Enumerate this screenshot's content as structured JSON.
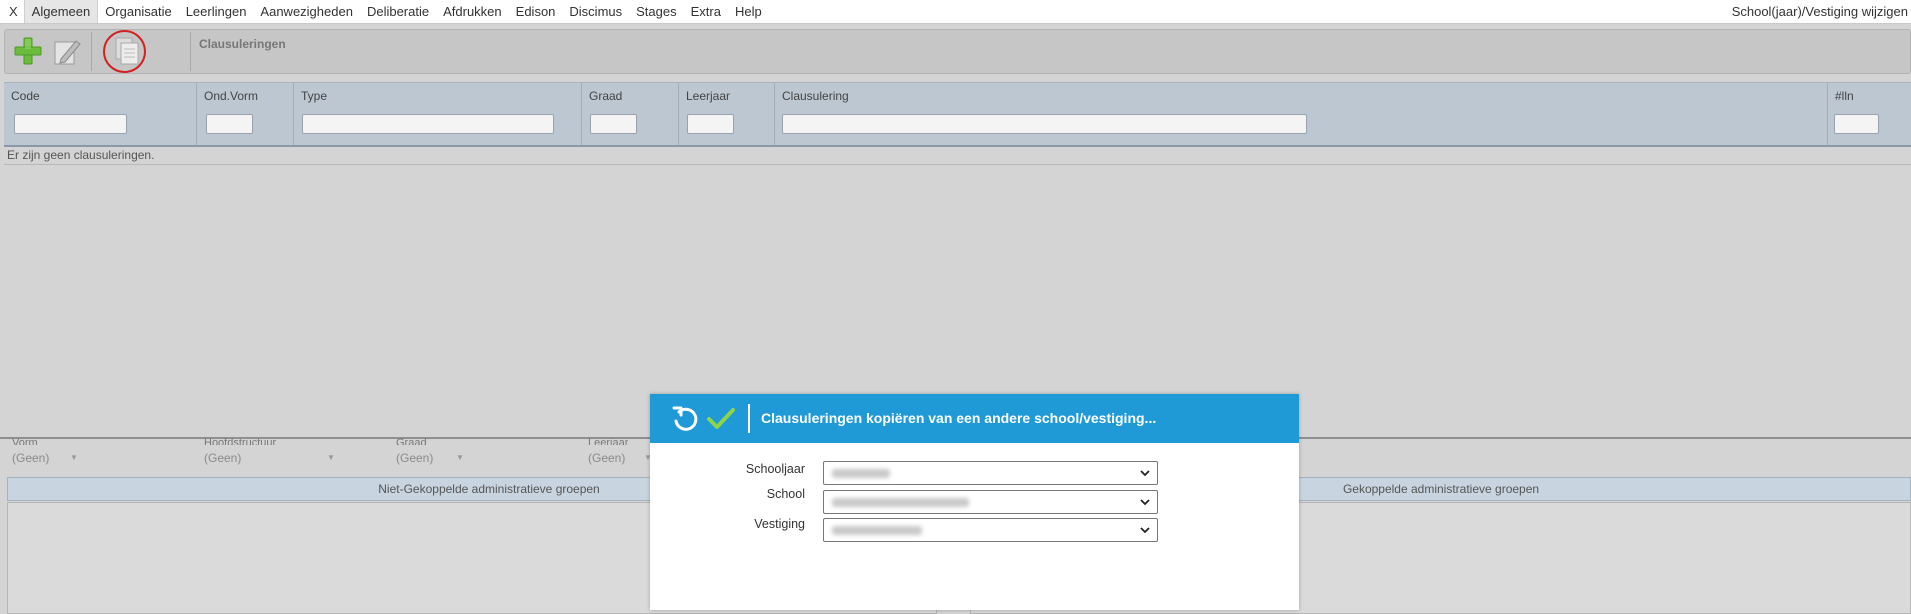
{
  "menu": {
    "close_label": "X",
    "items": [
      "Algemeen",
      "Organisatie",
      "Leerlingen",
      "Aanwezigheden",
      "Deliberatie",
      "Afdrukken",
      "Edison",
      "Discimus",
      "Stages",
      "Extra",
      "Help"
    ],
    "right_label": "School(jaar)/Vestiging wijzigen"
  },
  "toolbar": {
    "title": "Clausuleringen",
    "add_icon": "plus-icon",
    "edit_icon": "pencil-icon",
    "copy_icon": "copy-document-icon"
  },
  "grid": {
    "columns": [
      "Code",
      "Ond.Vorm",
      "Type",
      "Graad",
      "Leerjaar",
      "Clausulering",
      "#lln"
    ],
    "empty_message": "Er zijn geen clausuleringen."
  },
  "lower": {
    "filters": [
      {
        "label": "Vorm",
        "value": "(Geen)"
      },
      {
        "label": "Hoofdstructuur",
        "value": "(Geen)"
      },
      {
        "label": "Graad",
        "value": "(Geen)"
      },
      {
        "label": "Leerjaar",
        "value": "(Geen)"
      }
    ],
    "left_group_header": "Niet-Gekoppelde administratieve groepen",
    "right_group_header": "Gekoppelde administratieve groepen"
  },
  "dialog": {
    "title": "Clausuleringen kopiëren van een andere school/vestiging...",
    "undo_icon": "undo-icon",
    "confirm_icon": "checkmark-icon",
    "fields": [
      {
        "label": "Schooljaar"
      },
      {
        "label": "School"
      },
      {
        "label": "Vestiging"
      }
    ]
  },
  "colors": {
    "dialog_header": "#1f9ad6",
    "confirm_check": "#8ed44a",
    "highlight_circle": "#d02020"
  }
}
